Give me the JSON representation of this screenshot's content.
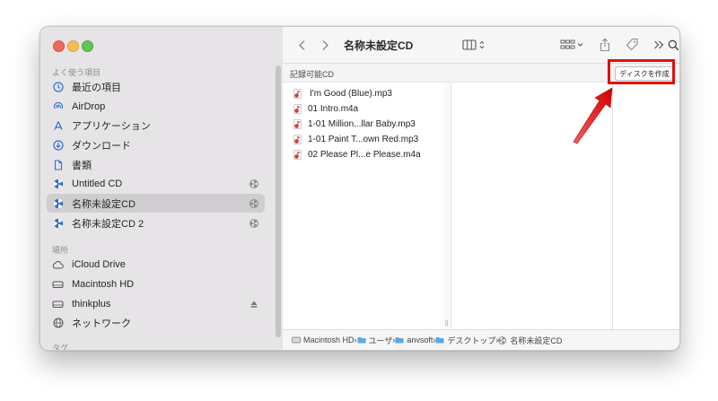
{
  "window": {
    "title": "名称未設定CD"
  },
  "sidebar": {
    "favorites_heading": "よく使う項目",
    "favorites": [
      {
        "label": "最近の項目",
        "icon": "clock-icon"
      },
      {
        "label": "AirDrop",
        "icon": "airdrop-icon"
      },
      {
        "label": "アプリケーション",
        "icon": "applications-icon"
      },
      {
        "label": "ダウンロード",
        "icon": "download-icon"
      },
      {
        "label": "書類",
        "icon": "document-icon"
      },
      {
        "label": "Untitled CD",
        "icon": "cd-icon",
        "trailing": "burn-icon"
      },
      {
        "label": "名称未設定CD",
        "icon": "cd-icon",
        "trailing": "burn-icon",
        "selected": true
      },
      {
        "label": "名称未設定CD 2",
        "icon": "cd-icon",
        "trailing": "burn-icon"
      }
    ],
    "locations_heading": "場所",
    "locations": [
      {
        "label": "iCloud Drive",
        "icon": "cloud-icon"
      },
      {
        "label": "Macintosh HD",
        "icon": "disk-icon"
      },
      {
        "label": "thinkplus",
        "icon": "disk-icon",
        "trailing": "eject-icon"
      },
      {
        "label": "ネットワーク",
        "icon": "globe-icon"
      }
    ],
    "tags_heading": "タグ"
  },
  "content": {
    "cd_label": "記録可能CD",
    "burn_button": "ディスクを作成",
    "files": [
      {
        "name": "I'm Good (Blue).mp3"
      },
      {
        "name": "01 Intro.m4a"
      },
      {
        "name": "1-01 Million...llar Baby.mp3"
      },
      {
        "name": "1-01 Paint T...own Red.mp3"
      },
      {
        "name": "02 Please Pl...e Please.m4a"
      }
    ]
  },
  "path_bar": [
    {
      "label": "Macintosh HD",
      "icon": "disk-icon"
    },
    {
      "label": "ユーザ",
      "icon": "folder-icon"
    },
    {
      "label": "anvsoft",
      "icon": "folder-icon"
    },
    {
      "label": "デスクトップ",
      "icon": "folder-icon"
    },
    {
      "label": "名称未設定CD",
      "icon": "burn-icon"
    }
  ],
  "colors": {
    "accent_blue": "#2f6fd0",
    "highlight_red": "#e01010",
    "file_icon_red": "#d23a3a"
  }
}
